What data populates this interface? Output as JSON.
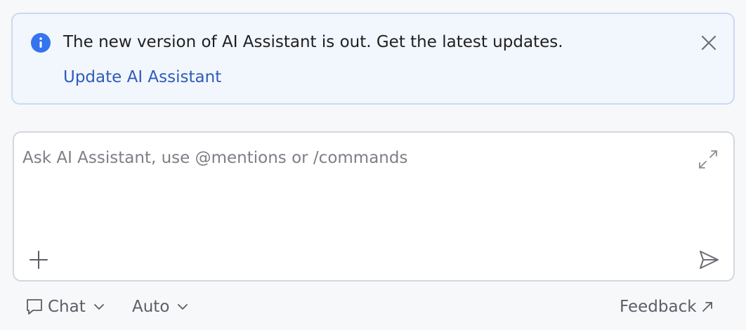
{
  "banner": {
    "message": "The new version of AI Assistant is out. Get the latest updates.",
    "update_link": "Update AI Assistant",
    "info_icon": "info-icon",
    "close_icon": "close-icon"
  },
  "input": {
    "placeholder": "Ask AI Assistant, use @mentions or /commands",
    "value": ""
  },
  "toolbar": {
    "chat_label": "Chat",
    "auto_label": "Auto",
    "feedback_label": "Feedback"
  },
  "colors": {
    "accent": "#3574f0",
    "link": "#2f5cb8",
    "banner_bg": "#f2f6fd",
    "banner_border": "#c9d9f6"
  }
}
